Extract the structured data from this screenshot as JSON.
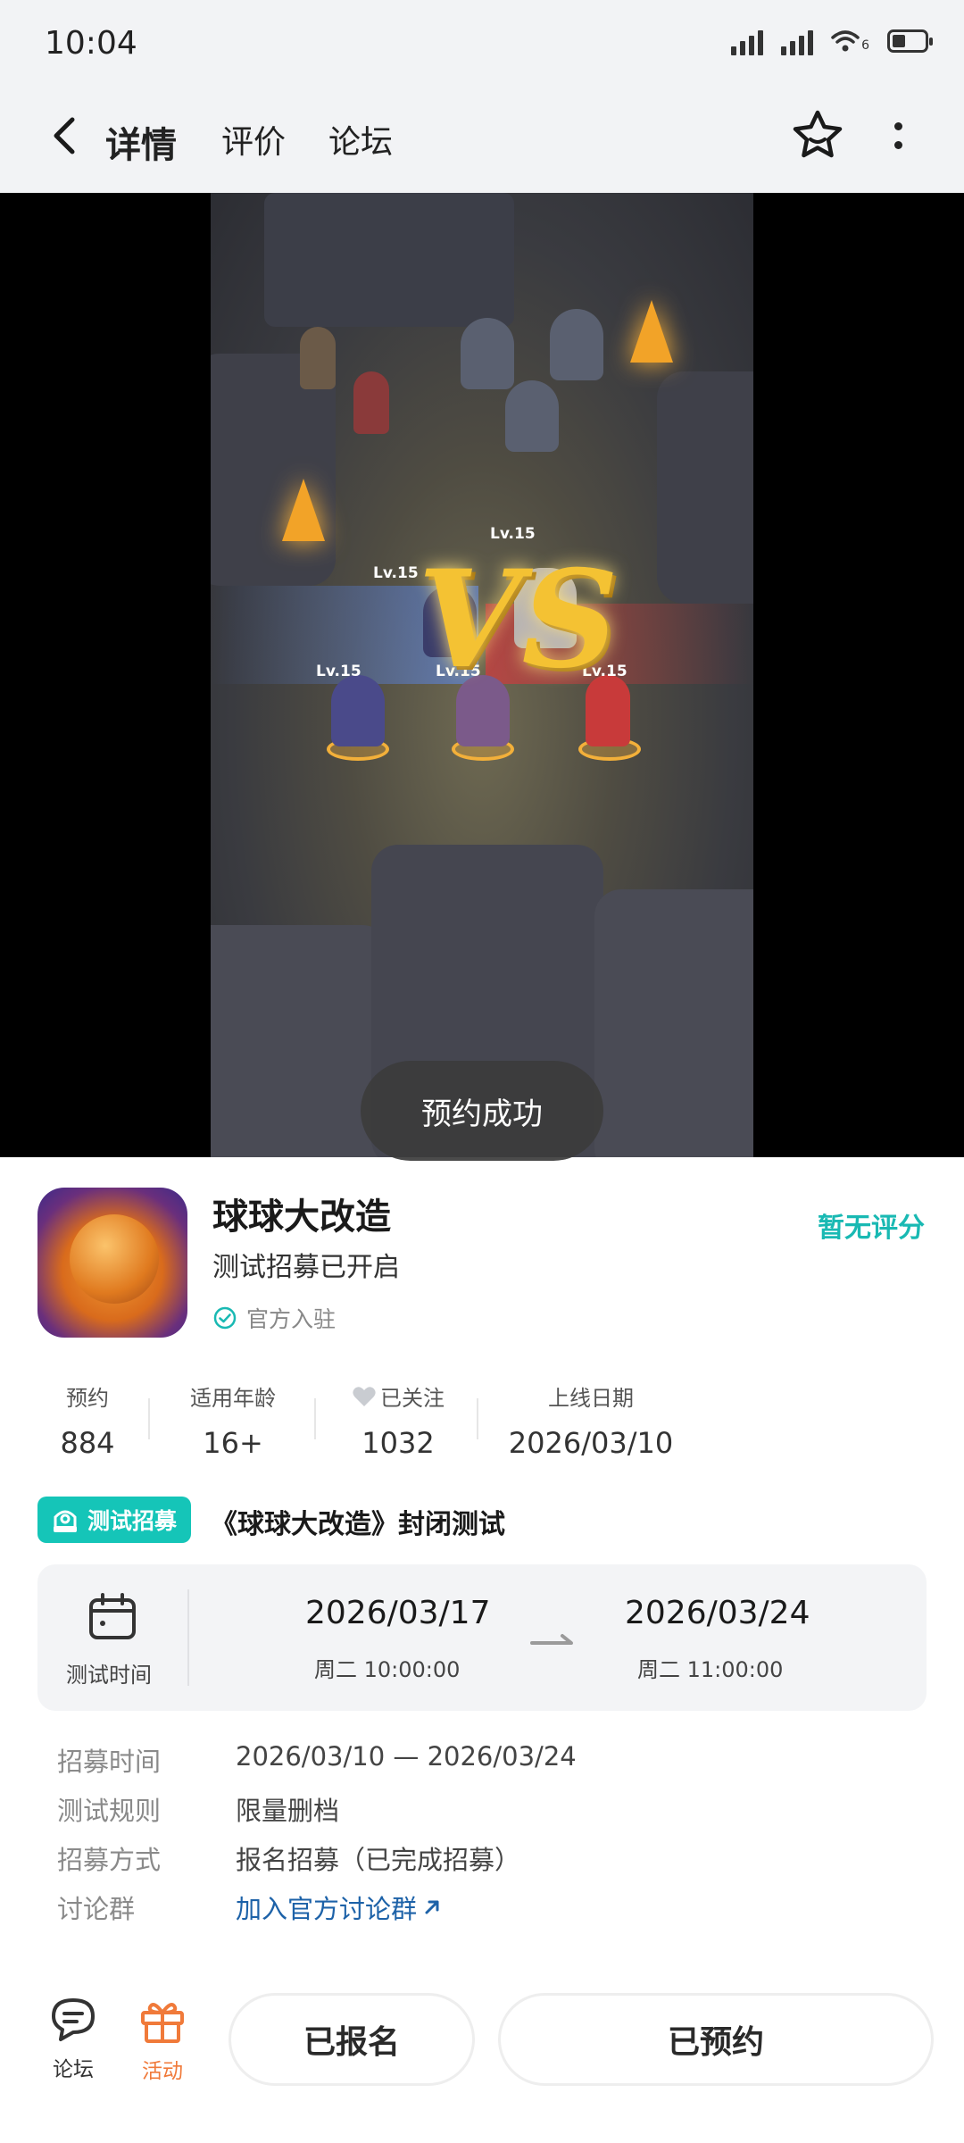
{
  "status_bar": {
    "time": "10:04",
    "network_label": "6"
  },
  "nav": {
    "tabs": [
      {
        "label": "详情"
      },
      {
        "label": "评价"
      },
      {
        "label": "论坛"
      }
    ]
  },
  "video": {
    "levels": [
      "Lv.15",
      "Lv.15",
      "Lv.15",
      "Lv.15",
      "Lv.15"
    ],
    "vs": "VS"
  },
  "toast": "预约成功",
  "app": {
    "name": "球球大改造",
    "subtitle": "测试招募已开启",
    "official": "官方入驻",
    "rating": "暂无评分"
  },
  "stats": [
    {
      "label": "预约",
      "value": "884"
    },
    {
      "label": "适用年龄",
      "value": "16+"
    },
    {
      "label": "已关注",
      "value": "1032"
    },
    {
      "label": "上线日期",
      "value": "2026/03/10"
    }
  ],
  "recruit": {
    "badge": "测试招募",
    "title": "《球球大改造》封闭测试",
    "test_time_label": "测试时间",
    "start": {
      "date": "2026/03/17",
      "detail": "周二  10:00:00"
    },
    "end": {
      "date": "2026/03/24",
      "detail": "周二  11:00:00"
    },
    "rows": [
      {
        "key": "招募时间",
        "value": "2026/03/10 — 2026/03/24"
      },
      {
        "key": "测试规则",
        "value": "限量删档"
      },
      {
        "key": "招募方式",
        "value": "报名招募（已完成招募）"
      },
      {
        "key": "讨论群",
        "value": "加入官方讨论群"
      }
    ]
  },
  "bottom": {
    "forum": "论坛",
    "activity": "活动",
    "signed_up": "已报名",
    "reserved": "已预约"
  },
  "colors": {
    "accent": "#15c5b8",
    "activity": "#f07a3a",
    "link": "#1d62a8"
  }
}
